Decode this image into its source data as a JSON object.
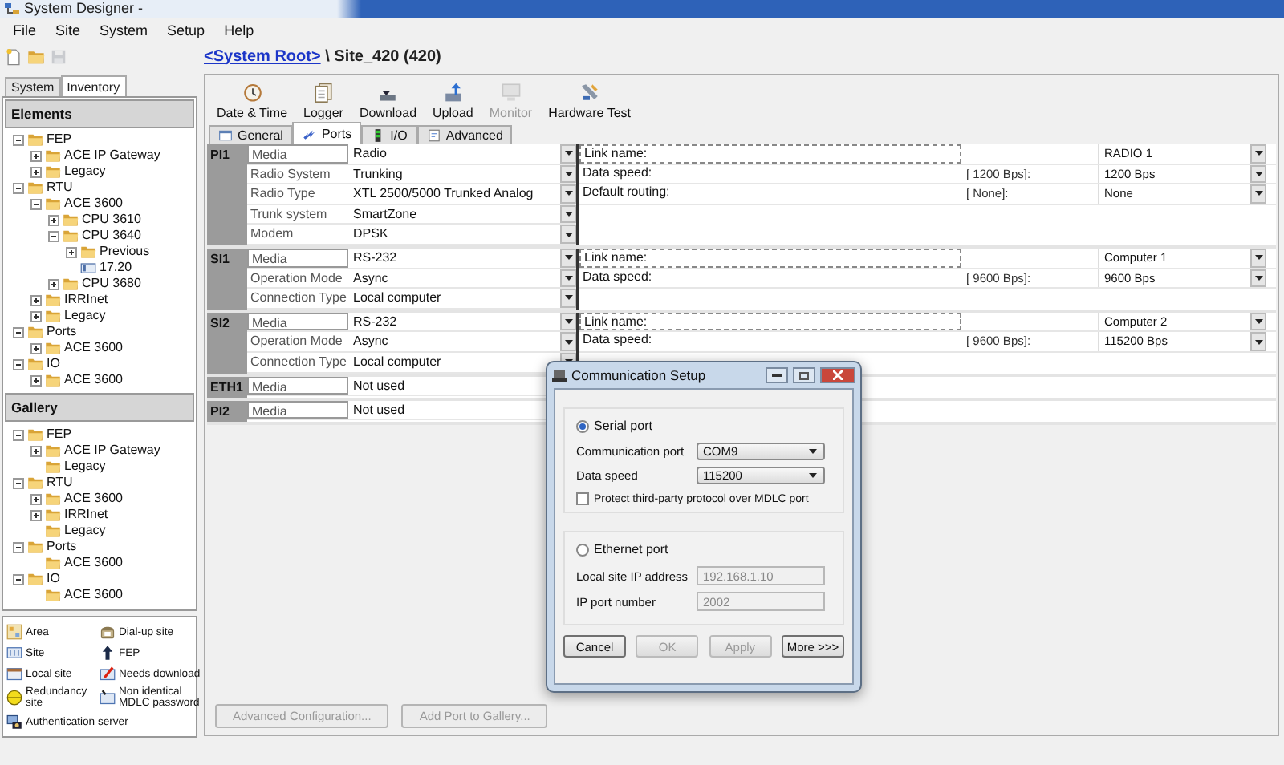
{
  "window": {
    "title": "System Designer -"
  },
  "menu": [
    "File",
    "Site",
    "System",
    "Setup",
    "Help"
  ],
  "toolbar": [
    {
      "kind": "new",
      "disabled": false
    },
    {
      "kind": "open",
      "disabled": false
    },
    {
      "kind": "save",
      "disabled": true
    }
  ],
  "breadcrumb": {
    "link": "<System Root>",
    "text": "\\ Site_420 (420)"
  },
  "sidebar": {
    "tabs": [
      {
        "label": "System",
        "selected": false
      },
      {
        "label": "Inventory",
        "selected": true
      }
    ],
    "elements": {
      "title": "Elements",
      "tree": [
        {
          "kind": "folder",
          "label": "FEP",
          "expanded": true,
          "children": [
            {
              "kind": "folder",
              "label": "ACE IP Gateway",
              "expanded": false
            },
            {
              "kind": "folder",
              "label": "Legacy",
              "expanded": false
            }
          ]
        },
        {
          "kind": "folder",
          "label": "RTU",
          "expanded": true,
          "children": [
            {
              "kind": "folder",
              "label": "ACE 3600",
              "expanded": true,
              "children": [
                {
                  "kind": "folder",
                  "label": "CPU 3610",
                  "expanded": false
                },
                {
                  "kind": "folder",
                  "label": "CPU 3640",
                  "expanded": true,
                  "children": [
                    {
                      "kind": "folder",
                      "label": "Previous",
                      "expanded": false
                    },
                    {
                      "kind": "version",
                      "label": "17.20"
                    }
                  ]
                },
                {
                  "kind": "folder",
                  "label": "CPU 3680",
                  "expanded": false
                }
              ]
            },
            {
              "kind": "folder",
              "label": "IRRInet",
              "expanded": false
            },
            {
              "kind": "folder",
              "label": "Legacy",
              "expanded": false
            }
          ]
        },
        {
          "kind": "folder",
          "label": "Ports",
          "expanded": true,
          "children": [
            {
              "kind": "folder",
              "label": "ACE 3600",
              "expanded": false
            }
          ]
        },
        {
          "kind": "folder",
          "label": "IO",
          "expanded": true,
          "children": [
            {
              "kind": "folder",
              "label": "ACE 3600",
              "expanded": false
            }
          ]
        }
      ]
    },
    "gallery": {
      "title": "Gallery",
      "tree": [
        {
          "kind": "folder",
          "label": "FEP",
          "expanded": true,
          "children": [
            {
              "kind": "folder",
              "label": "ACE IP Gateway",
              "expanded": false
            },
            {
              "kind": "folder",
              "label": "Legacy"
            }
          ]
        },
        {
          "kind": "folder",
          "label": "RTU",
          "expanded": true,
          "children": [
            {
              "kind": "folder",
              "label": "ACE 3600",
              "expanded": false
            },
            {
              "kind": "folder",
              "label": "IRRInet",
              "expanded": false
            },
            {
              "kind": "folder",
              "label": "Legacy"
            }
          ]
        },
        {
          "kind": "folder",
          "label": "Ports",
          "expanded": true,
          "children": [
            {
              "kind": "folder",
              "label": "ACE 3600"
            }
          ]
        },
        {
          "kind": "folder",
          "label": "IO",
          "expanded": true,
          "children": [
            {
              "kind": "folder",
              "label": "ACE 3600"
            }
          ]
        }
      ]
    },
    "legend": [
      {
        "kind": "area",
        "label": "Area"
      },
      {
        "kind": "dialup",
        "label": "Dial-up site"
      },
      {
        "kind": "site",
        "label": "Site"
      },
      {
        "kind": "fep",
        "label": "FEP"
      },
      {
        "kind": "local",
        "label": "Local site"
      },
      {
        "kind": "download",
        "label": "Needs download"
      },
      {
        "kind": "redundancy",
        "label": "Redundancy site"
      },
      {
        "kind": "mdlc",
        "label": "Non identical MDLC password"
      },
      {
        "kind": "auth",
        "label": "Authentication server"
      }
    ]
  },
  "site_toolbar": [
    {
      "kind": "clock",
      "label": "Date & Time",
      "disabled": false
    },
    {
      "kind": "logger",
      "label": "Logger",
      "disabled": false
    },
    {
      "kind": "download",
      "label": "Download",
      "disabled": false
    },
    {
      "kind": "upload",
      "label": "Upload",
      "disabled": false
    },
    {
      "kind": "monitor",
      "label": "Monitor",
      "disabled": true
    },
    {
      "kind": "hwtest",
      "label": "Hardware Test",
      "disabled": false
    }
  ],
  "tabs": [
    {
      "kind": "general",
      "label": "General",
      "selected": false
    },
    {
      "kind": "ports",
      "label": "Ports",
      "selected": true
    },
    {
      "kind": "io",
      "label": "I/O",
      "selected": false
    },
    {
      "kind": "advanced",
      "label": "Advanced",
      "selected": false
    }
  ],
  "ports": [
    {
      "name": "PI1",
      "fields": [
        {
          "label": "Media",
          "value": "Radio"
        },
        {
          "label": "Radio System",
          "value": "Trunking"
        },
        {
          "label": "Radio Type",
          "value": "XTL 2500/5000 Trunked Analog"
        },
        {
          "label": "Trunk system",
          "value": "SmartZone"
        },
        {
          "label": "Modem",
          "value": "DPSK"
        }
      ],
      "links": [
        {
          "kind": "name",
          "label": "Link name:",
          "value": "RADIO 1"
        },
        {
          "kind": "setting",
          "label": "Data speed:",
          "current": "[ 1200 Bps]:",
          "value": "1200 Bps"
        },
        {
          "kind": "setting",
          "label": "Default routing:",
          "current": "[ None]:",
          "value": "None"
        }
      ]
    },
    {
      "name": "SI1",
      "fields": [
        {
          "label": "Media",
          "value": "RS-232"
        },
        {
          "label": "Operation Mode",
          "value": "Async"
        },
        {
          "label": "Connection Type",
          "value": "Local computer"
        }
      ],
      "links": [
        {
          "kind": "name",
          "label": "Link name:",
          "value": "Computer 1"
        },
        {
          "kind": "setting",
          "label": "Data speed:",
          "current": "[ 9600 Bps]:",
          "value": "9600 Bps"
        }
      ]
    },
    {
      "name": "SI2",
      "fields": [
        {
          "label": "Media",
          "value": "RS-232"
        },
        {
          "label": "Operation Mode",
          "value": "Async"
        },
        {
          "label": "Connection Type",
          "value": "Local computer"
        }
      ],
      "links": [
        {
          "kind": "name",
          "label": "Link name:",
          "value": "Computer 2"
        },
        {
          "kind": "setting",
          "label": "Data speed:",
          "current": "[ 9600 Bps]:",
          "value": "115200 Bps"
        }
      ]
    },
    {
      "name": "ETH1",
      "fields": [
        {
          "label": "Media",
          "value": "Not used"
        }
      ]
    },
    {
      "name": "PI2",
      "fields": [
        {
          "label": "Media",
          "value": "Not used"
        }
      ]
    }
  ],
  "actions": [
    {
      "label": "Advanced Configuration...",
      "disabled": true
    },
    {
      "label": "Add Port to Gallery...",
      "disabled": true
    }
  ],
  "dialog": {
    "title": "Communication Setup",
    "serial": {
      "label": "Serial port",
      "selected": true,
      "fields": [
        {
          "label": "Communication port",
          "value": "COM9"
        },
        {
          "label": "Data speed",
          "value": "115200"
        }
      ],
      "checkbox": {
        "label": "Protect third-party protocol over MDLC port",
        "checked": false
      }
    },
    "ethernet": {
      "label": "Ethernet port",
      "selected": false,
      "fields": [
        {
          "label": "Local site IP address",
          "value": "192.168.1.10"
        },
        {
          "label": "IP port number",
          "value": "2002"
        }
      ]
    },
    "buttons": [
      {
        "label": "Cancel",
        "disabled": false
      },
      {
        "label": "OK",
        "disabled": true
      },
      {
        "label": "Apply",
        "disabled": true
      },
      {
        "label": "More >>>",
        "disabled": false
      }
    ]
  }
}
